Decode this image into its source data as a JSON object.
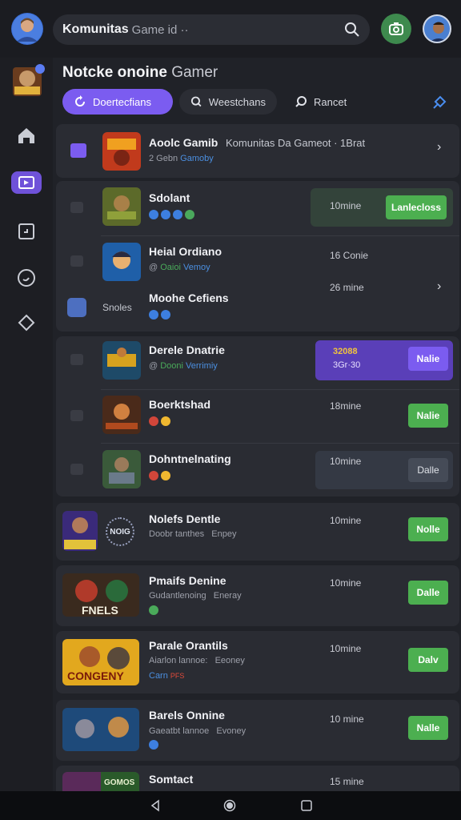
{
  "topbar": {
    "title": "Komunitas",
    "subtitle": "Game id ··"
  },
  "header": {
    "title": "Notcke onoine",
    "title_thin": "Gamer"
  },
  "filters": [
    {
      "label": "Doertecfians"
    },
    {
      "label": "Weestchans"
    },
    {
      "label": "Rancet"
    }
  ],
  "sidebar": {
    "icons": [
      "home-icon",
      "games-icon",
      "calendar-icon",
      "support-icon",
      "diamond-icon"
    ]
  },
  "featured": {
    "name": "Aoolc Gamib",
    "community": "Komunitas Da Gameot · 1Brat",
    "meta_prefix": "2 Gebn",
    "meta_blue": "Gamoby"
  },
  "groups": [
    {
      "rows": [
        {
          "name": "Sdolant",
          "time": "10mine",
          "button": "Lanlecloss"
        },
        {
          "name": "Heial Ordiano",
          "meta_prefix": "@",
          "meta_green": "Oaioi",
          "meta_blue": "Vemoy",
          "time": "16 Conie"
        },
        {
          "name": "Moohe Cefiens",
          "side_label": "Snoles",
          "time": "26 mine"
        }
      ]
    },
    {
      "rows": [
        {
          "name": "Derele Dnatrie",
          "meta_prefix": "@",
          "meta_green": "Dooni",
          "meta_blue": "Verrimiy",
          "promo_line1": "32088",
          "promo_line2": "3Gr·30",
          "button": "Nalie"
        },
        {
          "name": "Boerktshad",
          "time": "18mine",
          "button": "Nalie"
        },
        {
          "name": "Dohntnelnating",
          "time": "10mine",
          "button": "Dalle"
        }
      ]
    }
  ],
  "list": [
    {
      "name": "Nolefs Dentle",
      "meta": "Doobr tanthes",
      "meta2": "Enpey",
      "time": "10mine",
      "button": "Nolle",
      "logo": "NOIG"
    },
    {
      "name": "Pmaifs Denine",
      "meta": "Gudantlenoing",
      "meta2": "Eneray",
      "time": "10mine",
      "button": "Dalle",
      "art": "FNELS"
    },
    {
      "name": "Parale Orantils",
      "meta": "Aiarlon lannoe:",
      "meta2": "Eeoney",
      "meta_blue": "Carn",
      "meta_red": "PFS",
      "time": "10mine",
      "button": "Dalv",
      "art": "CONGENY"
    },
    {
      "name": "Barels Onnine",
      "meta": "Gaeatbt lannoe",
      "meta2": "Evoney",
      "time": "10 mine",
      "button": "Nalle"
    },
    {
      "name": "Somtact",
      "time": "15 mine",
      "art": "GOMOS"
    }
  ],
  "colors": {
    "accent": "#7b5cf0",
    "green": "#4caf50",
    "background": "#202228",
    "card": "#2a2c33"
  }
}
